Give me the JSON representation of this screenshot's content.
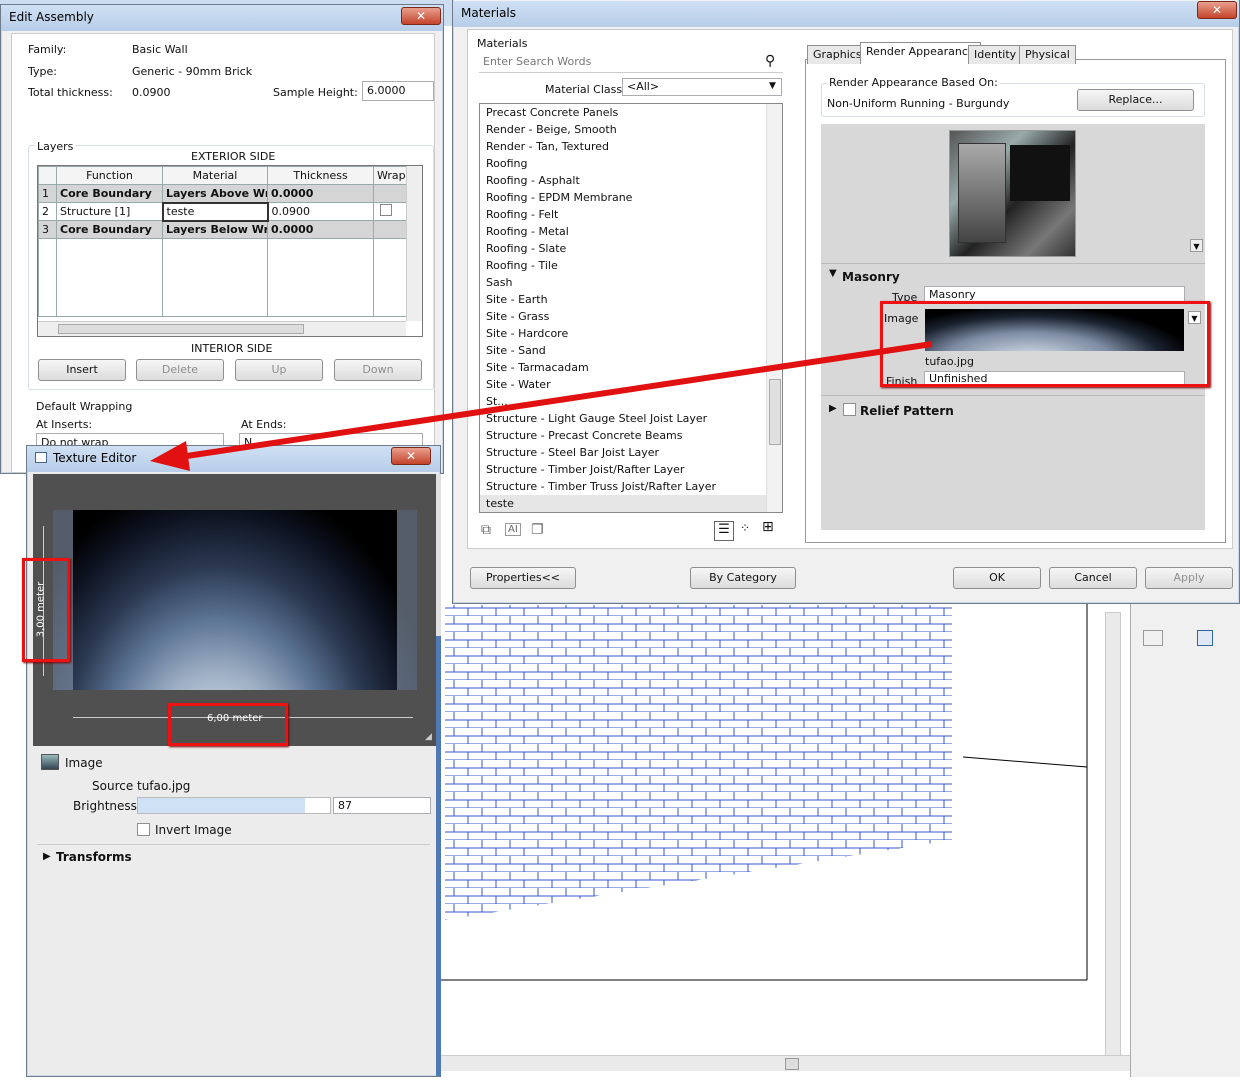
{
  "edit_assembly": {
    "title": "Edit Assembly",
    "family_label": "Family:",
    "family_value": "Basic Wall",
    "type_label": "Type:",
    "type_value": "Generic - 90mm Brick",
    "thickness_label": "Total thickness:",
    "thickness_value": "0.0900",
    "sample_label": "Sample Height:",
    "sample_value": "6.0000",
    "layers_label": "Layers",
    "exterior": "EXTERIOR SIDE",
    "interior": "INTERIOR SIDE",
    "columns": [
      "Function",
      "Material",
      "Thickness",
      "Wrap"
    ],
    "rows": [
      {
        "num": "1",
        "function": "Core Boundary",
        "material": "Layers Above Wr",
        "thickness": "0.0000"
      },
      {
        "num": "2",
        "function": "Structure [1]",
        "material": "teste",
        "thickness": "0.0900"
      },
      {
        "num": "3",
        "function": "Core Boundary",
        "material": "Layers Below Wra",
        "thickness": "0.0000"
      }
    ],
    "buttons": {
      "insert": "Insert",
      "delete": "Delete",
      "up": "Up",
      "down": "Down"
    },
    "wrapping_label": "Default Wrapping",
    "at_inserts": "At Inserts:",
    "at_ends": "At Ends:",
    "inserts_value": "Do not wrap",
    "ends_value": "N"
  },
  "materials": {
    "title": "Materials",
    "group_label": "Materials",
    "search_placeholder": "Enter Search Words",
    "class_label": "Material Class:",
    "class_value": "<All>",
    "list": [
      "Precast Concrete Panels",
      "Render - Beige, Smooth",
      "Render - Tan, Textured",
      "Roofing",
      "Roofing - Asphalt",
      "Roofing - EPDM Membrane",
      "Roofing - Felt",
      "Roofing - Metal",
      "Roofing - Slate",
      "Roofing - Tile",
      "Sash",
      "Site - Earth",
      "Site - Grass",
      "Site - Hardcore",
      "Site - Sand",
      "Site - Tarmacadam",
      "Site - Water",
      "St...",
      "Structure - Light Gauge Steel Joist Layer",
      "Structure - Precast Concrete Beams",
      "Structure - Steel Bar Joist Layer",
      "Structure - Timber Joist/Rafter Layer",
      "Structure - Timber Truss Joist/Rafter Layer",
      "teste"
    ],
    "tabs": [
      "Graphics",
      "Render Appearance",
      "Identity",
      "Physical"
    ],
    "based_on_label": "Render Appearance Based On:",
    "based_on_value": "Non-Uniform Running - Burgundy",
    "replace": "Replace...",
    "masonry": "Masonry",
    "type_label": "Type",
    "type_value": "Masonry",
    "image_label": "Image",
    "image_file": "tufao.jpg",
    "finish_label": "Finish",
    "finish_value": "Unfinished",
    "relief": "Relief Pattern",
    "properties_btn": "Properties<<",
    "category_btn": "By Category",
    "ok": "OK",
    "cancel": "Cancel",
    "apply": "Apply"
  },
  "texture_editor": {
    "title": "Texture Editor",
    "height_dim": "3,00 meter",
    "width_dim": "6,00 meter",
    "image_label": "Image",
    "source_label": "Source",
    "source_value": "tufao.jpg",
    "brightness_label": "Brightness",
    "brightness_value": "87",
    "brightness_fill": 0.87,
    "invert": "Invert Image",
    "transforms": "Transforms"
  },
  "colors": {
    "accent": "#e11111",
    "brick_line": "#3355cc"
  }
}
